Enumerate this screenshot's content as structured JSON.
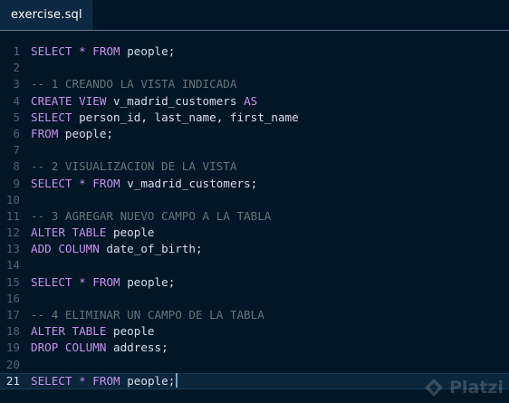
{
  "tab": {
    "label": "exercise.sql"
  },
  "colors": {
    "background": "#011627",
    "keyword": "#c792ea",
    "comment": "#637777",
    "identifier": "#d6deeb",
    "line_number": "#4b6479"
  },
  "lines": [
    {
      "n": "1",
      "tokens": [
        [
          "kw",
          "SELECT"
        ],
        [
          "id",
          " "
        ],
        [
          "op",
          "*"
        ],
        [
          "id",
          " "
        ],
        [
          "kw",
          "FROM"
        ],
        [
          "id",
          " people;"
        ]
      ]
    },
    {
      "n": "2",
      "tokens": []
    },
    {
      "n": "3",
      "tokens": [
        [
          "cm",
          "-- 1 CREANDO LA VISTA INDICADA"
        ]
      ]
    },
    {
      "n": "4",
      "tokens": [
        [
          "kw",
          "CREATE VIEW"
        ],
        [
          "id",
          " v_madrid_customers "
        ],
        [
          "kw",
          "AS"
        ]
      ]
    },
    {
      "n": "5",
      "tokens": [
        [
          "kw",
          "SELECT"
        ],
        [
          "id",
          " person_id, last_name, first_name"
        ]
      ]
    },
    {
      "n": "6",
      "tokens": [
        [
          "kw",
          "FROM"
        ],
        [
          "id",
          " people;"
        ]
      ]
    },
    {
      "n": "7",
      "tokens": []
    },
    {
      "n": "8",
      "tokens": [
        [
          "cm",
          "-- 2 VISUALIZACION DE LA VISTA"
        ]
      ]
    },
    {
      "n": "9",
      "tokens": [
        [
          "kw",
          "SELECT"
        ],
        [
          "id",
          " "
        ],
        [
          "op",
          "*"
        ],
        [
          "id",
          " "
        ],
        [
          "kw",
          "FROM"
        ],
        [
          "id",
          " v_madrid_customers;"
        ]
      ]
    },
    {
      "n": "10",
      "tokens": []
    },
    {
      "n": "11",
      "tokens": [
        [
          "cm",
          "-- 3 AGREGAR NUEVO CAMPO A LA TABLA"
        ]
      ]
    },
    {
      "n": "12",
      "tokens": [
        [
          "kw",
          "ALTER TABLE"
        ],
        [
          "id",
          " people"
        ]
      ]
    },
    {
      "n": "13",
      "tokens": [
        [
          "kw",
          "ADD COLUMN"
        ],
        [
          "id",
          " date_of_birth;"
        ]
      ]
    },
    {
      "n": "14",
      "tokens": []
    },
    {
      "n": "15",
      "tokens": [
        [
          "kw",
          "SELECT"
        ],
        [
          "id",
          " "
        ],
        [
          "op",
          "*"
        ],
        [
          "id",
          " "
        ],
        [
          "kw",
          "FROM"
        ],
        [
          "id",
          " people;"
        ]
      ]
    },
    {
      "n": "16",
      "tokens": []
    },
    {
      "n": "17",
      "tokens": [
        [
          "cm",
          "-- 4 ELIMINAR UN CAMPO DE LA TABLA"
        ]
      ]
    },
    {
      "n": "18",
      "tokens": [
        [
          "kw",
          "ALTER TABLE"
        ],
        [
          "id",
          " people"
        ]
      ]
    },
    {
      "n": "19",
      "tokens": [
        [
          "kw",
          "DROP COLUMN"
        ],
        [
          "id",
          " address;"
        ]
      ]
    },
    {
      "n": "20",
      "tokens": []
    },
    {
      "n": "21",
      "tokens": [
        [
          "kw",
          "SELECT"
        ],
        [
          "id",
          " "
        ],
        [
          "op",
          "*"
        ],
        [
          "id",
          " "
        ],
        [
          "kw",
          "FROM"
        ],
        [
          "id",
          " people;"
        ]
      ],
      "current": true
    }
  ],
  "watermark": {
    "text": "Platzi",
    "icon": "platzi-logo-icon"
  }
}
